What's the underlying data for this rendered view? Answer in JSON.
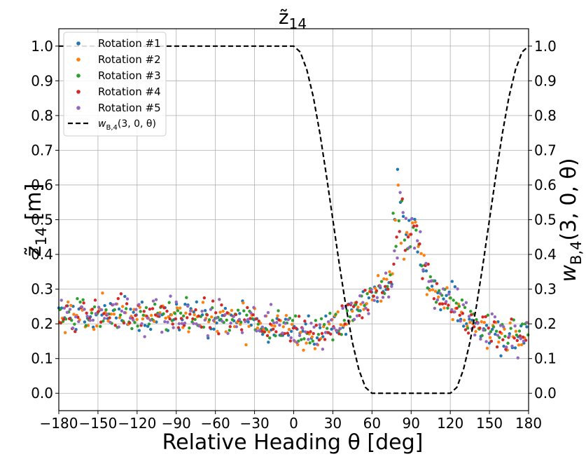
{
  "chart_data": {
    "type": "scatter",
    "title": "z̃",
    "title_sub": "14",
    "xlabel": "Relative Heading θ [deg]",
    "ylabel_left_main": "z̃",
    "ylabel_left_sub": "14",
    "ylabel_left_unit": " [m]",
    "ylabel_right": "w",
    "ylabel_right_sub": "B,4",
    "ylabel_right_args": "(3, 0, θ)",
    "xlim": [
      -180,
      180
    ],
    "ylim": [
      -0.05,
      1.05
    ],
    "xticks": [
      -180,
      -150,
      -120,
      -90,
      -60,
      -30,
      0,
      30,
      60,
      90,
      120,
      150,
      180
    ],
    "xtick_labels": [
      "−180",
      "−150",
      "−120",
      "−90",
      "−60",
      "−30",
      "0",
      "30",
      "60",
      "90",
      "120",
      "150",
      "180"
    ],
    "yticks": [
      0.0,
      0.1,
      0.2,
      0.3,
      0.4,
      0.5,
      0.6,
      0.7,
      0.8,
      0.9,
      1.0
    ],
    "ytick_labels": [
      "0.0",
      "0.1",
      "0.2",
      "0.3",
      "0.4",
      "0.5",
      "0.6",
      "0.7",
      "0.8",
      "0.9",
      "1.0"
    ],
    "grid": true,
    "legend_position": "top-left",
    "series": [
      {
        "name": "Rotation #1",
        "color": "#1f77b4"
      },
      {
        "name": "Rotation #2",
        "color": "#ff7f0e"
      },
      {
        "name": "Rotation #3",
        "color": "#2ca02c"
      },
      {
        "name": "Rotation #4",
        "color": "#d62728"
      },
      {
        "name": "Rotation #5",
        "color": "#9467bd"
      }
    ],
    "trend": {
      "x": [
        -180,
        -150,
        -120,
        -100,
        -90,
        -75,
        -60,
        -45,
        -30,
        -15,
        0,
        10,
        20,
        30,
        40,
        50,
        60,
        65,
        70,
        75,
        78,
        80,
        82,
        85,
        88,
        90,
        92,
        95,
        100,
        105,
        110,
        120,
        130,
        140,
        150,
        160,
        170,
        180
      ],
      "y": [
        0.22,
        0.23,
        0.22,
        0.22,
        0.22,
        0.22,
        0.21,
        0.21,
        0.21,
        0.2,
        0.19,
        0.17,
        0.17,
        0.19,
        0.22,
        0.25,
        0.28,
        0.29,
        0.3,
        0.33,
        0.38,
        0.45,
        0.44,
        0.42,
        0.45,
        0.48,
        0.47,
        0.43,
        0.35,
        0.3,
        0.27,
        0.27,
        0.23,
        0.2,
        0.18,
        0.16,
        0.16,
        0.18
      ],
      "spread": 0.035
    },
    "weight_legend": "w",
    "weight_legend_sub": "B,4",
    "weight_legend_args": "(3, 0, θ)",
    "weight_curve": {
      "color": "#000000",
      "style": "dashed",
      "x": [
        -180,
        0,
        5,
        10,
        15,
        20,
        25,
        30,
        35,
        40,
        45,
        50,
        55,
        60,
        120,
        125,
        130,
        135,
        140,
        145,
        150,
        155,
        160,
        165,
        170,
        175,
        180
      ],
      "y": [
        1.0,
        1.0,
        0.983,
        0.933,
        0.854,
        0.75,
        0.629,
        0.5,
        0.371,
        0.25,
        0.146,
        0.067,
        0.017,
        0.0,
        0.0,
        0.017,
        0.067,
        0.146,
        0.25,
        0.371,
        0.5,
        0.629,
        0.75,
        0.854,
        0.933,
        0.983,
        1.0
      ]
    }
  }
}
